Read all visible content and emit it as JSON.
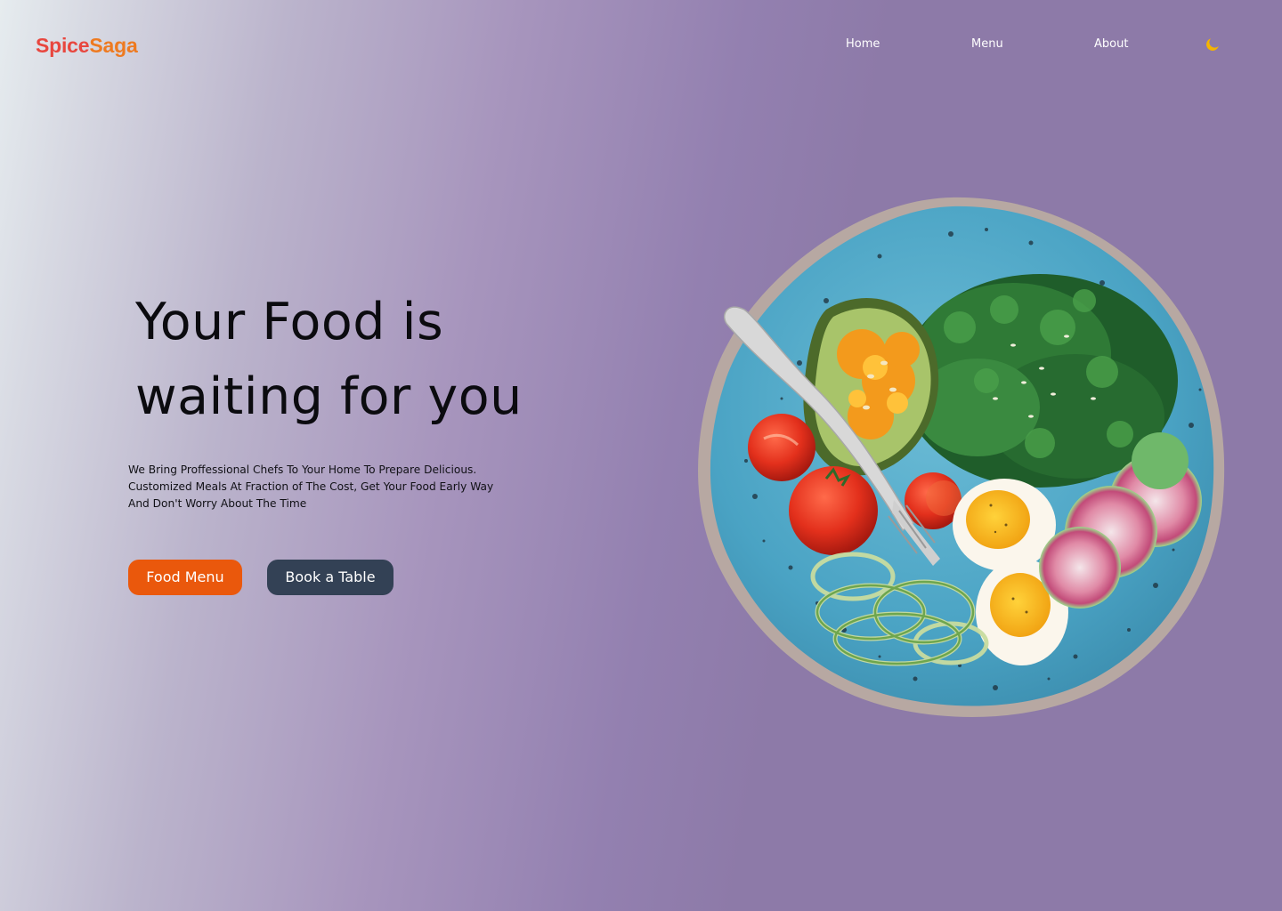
{
  "brand": {
    "part1": "Spice",
    "part2": "Saga",
    "color1": "#e8473f",
    "color2": "#ee7a20"
  },
  "nav": {
    "home": "Home",
    "menu": "Menu",
    "about": "About",
    "theme_icon": "moon-icon",
    "theme_icon_color": "#f5b400"
  },
  "hero": {
    "title_line1": "Your Food is",
    "title_line2": "waiting for you",
    "desc_line1": "We Bring Proffessional Chefs To Your Home To Prepare Delicious.",
    "desc_line2": "Customized Meals At Fraction of The Cost, Get Your Food Early Way",
    "desc_line3": "And Don't Worry About The Time",
    "primary_button": "Food Menu",
    "secondary_button": "Book a Table",
    "primary_color": "#ea580c",
    "secondary_color": "#334155"
  },
  "image": {
    "subject": "salad-bowl-image"
  },
  "colors": {
    "background_right": "#8d7aa8",
    "background_left": "#e6ecef"
  }
}
